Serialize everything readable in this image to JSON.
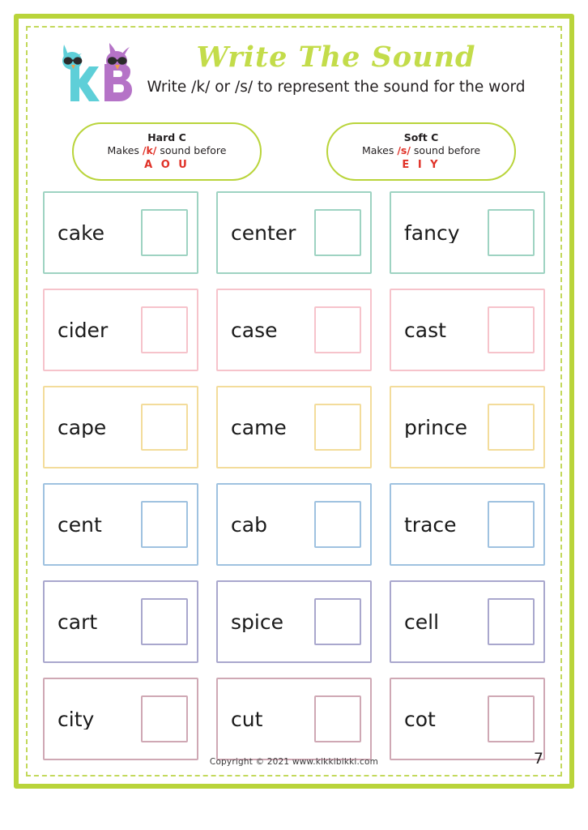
{
  "header": {
    "logo_alt": "kikkibikki-logo",
    "title": "Write The Sound",
    "subtitle": "Write /k/ or /s/ to represent the sound for the word",
    "title_color": "#c3dc4a"
  },
  "rules": [
    {
      "name": "hard-c",
      "title": "Hard C",
      "desc_before": "Makes ",
      "desc_sound": "/k/",
      "desc_after": " sound before",
      "letters": "A O U"
    },
    {
      "name": "soft-c",
      "title": "Soft C",
      "desc_before": "Makes ",
      "desc_sound": "/s/",
      "desc_after": " sound before",
      "letters": "E I Y"
    }
  ],
  "rule_accent_color": "#e03127",
  "frame_color": "#b9d43a",
  "row_colors": [
    "#9ed3c2",
    "#f6c3cb",
    "#f3dc9b",
    "#9fc2e0",
    "#a9a7cd",
    "#cfa8b4"
  ],
  "cards": [
    {
      "word": "cake",
      "row": 0
    },
    {
      "word": "center",
      "row": 0
    },
    {
      "word": "fancy",
      "row": 0
    },
    {
      "word": "cider",
      "row": 1
    },
    {
      "word": "case",
      "row": 1
    },
    {
      "word": "cast",
      "row": 1
    },
    {
      "word": "cape",
      "row": 2
    },
    {
      "word": "came",
      "row": 2
    },
    {
      "word": "prince",
      "row": 2
    },
    {
      "word": "cent",
      "row": 3
    },
    {
      "word": "cab",
      "row": 3
    },
    {
      "word": "trace",
      "row": 3
    },
    {
      "word": "cart",
      "row": 4
    },
    {
      "word": "spice",
      "row": 4
    },
    {
      "word": "cell",
      "row": 4
    },
    {
      "word": "city",
      "row": 5
    },
    {
      "word": "cut",
      "row": 5
    },
    {
      "word": "cot",
      "row": 5
    }
  ],
  "footer": {
    "copyright": "Copyright © 2021 www.kikkibikki.com",
    "page_number": "7"
  }
}
